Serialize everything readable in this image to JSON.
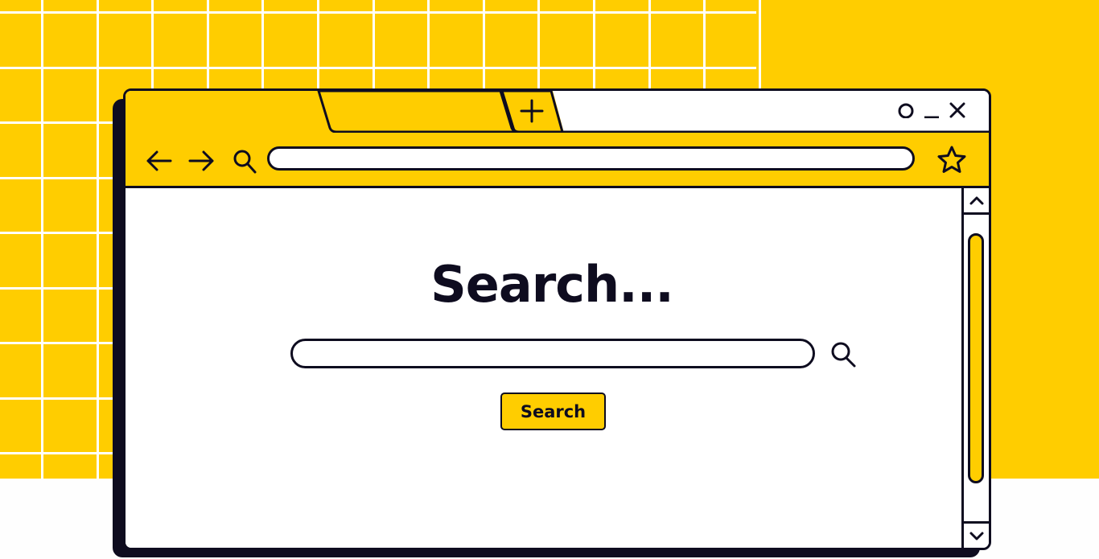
{
  "background": {
    "accent_color": "#ffcd00",
    "ink_color": "#0e0c1f",
    "grid_line_color": "#ffffff"
  },
  "browser": {
    "tabs": [
      {
        "label": "",
        "active": true
      },
      {
        "label": "",
        "active": false
      }
    ],
    "new_tab_icon": "plus-icon",
    "window_controls": [
      "circle-icon",
      "minimize-icon",
      "close-icon"
    ],
    "nav": {
      "back_icon": "arrow-left-icon",
      "forward_icon": "arrow-right-icon",
      "search_icon": "search-icon",
      "bookmark_icon": "star-icon"
    },
    "address_bar": {
      "value": "",
      "placeholder": ""
    }
  },
  "page": {
    "heading": "Search...",
    "search_input": {
      "value": "",
      "placeholder": ""
    },
    "search_button_label": "Search"
  },
  "scrollbar": {
    "up_icon": "chevron-up-icon",
    "down_icon": "chevron-down-icon",
    "thumb_start_fraction": 0.06,
    "thumb_size_fraction": 0.8
  }
}
